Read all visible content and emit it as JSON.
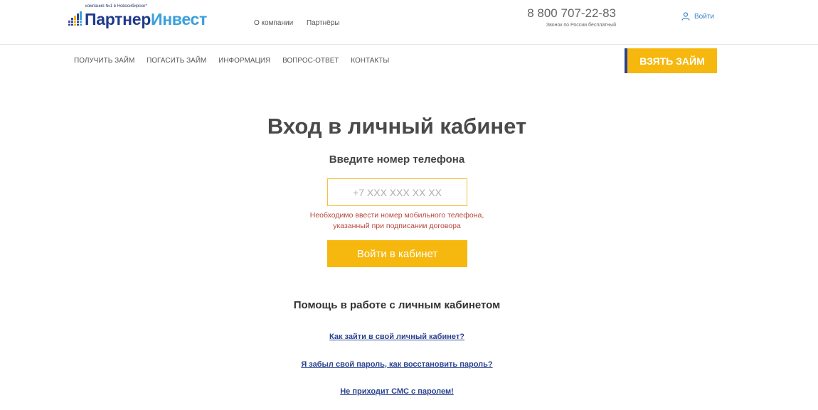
{
  "header": {
    "logo": {
      "tagline": "компания №1 в Новосибирске*",
      "name_part1": "Партнер",
      "name_part2": "Инвест"
    },
    "top_links": [
      "О компании",
      "Партнёры"
    ],
    "phone": "8 800 707-22-83",
    "phone_note": "Звонок по России бесплатный",
    "login_label": "Войти"
  },
  "nav": {
    "items": [
      "Получить займ",
      "Погасить займ",
      "Информация",
      "Вопрос-ответ",
      "Контакты"
    ],
    "cta_label": "ВЗЯТЬ ЗАЙМ"
  },
  "main": {
    "title": "Вход в личный кабинет",
    "subtitle": "Введите номер телефона",
    "phone_input": {
      "placeholder": "+7 XXX XXX XX XX",
      "value": ""
    },
    "error_line1": "Необходимо ввести номер мобильного телефона,",
    "error_line2": "указанный при подписании договора",
    "submit_label": "Войти в кабинет"
  },
  "help": {
    "title": "Помощь в работе с личным кабинетом",
    "links": [
      "Как зайти в свой личный кабинет?",
      "Я забыл свой пароль, как восстановить пароль?",
      "Не приходит СМС с паролем!"
    ]
  },
  "colors": {
    "accent_yellow": "#f6b80f",
    "brand_blue": "#2b4390",
    "link_blue": "#3a86c8",
    "error_red": "#b8473a"
  }
}
